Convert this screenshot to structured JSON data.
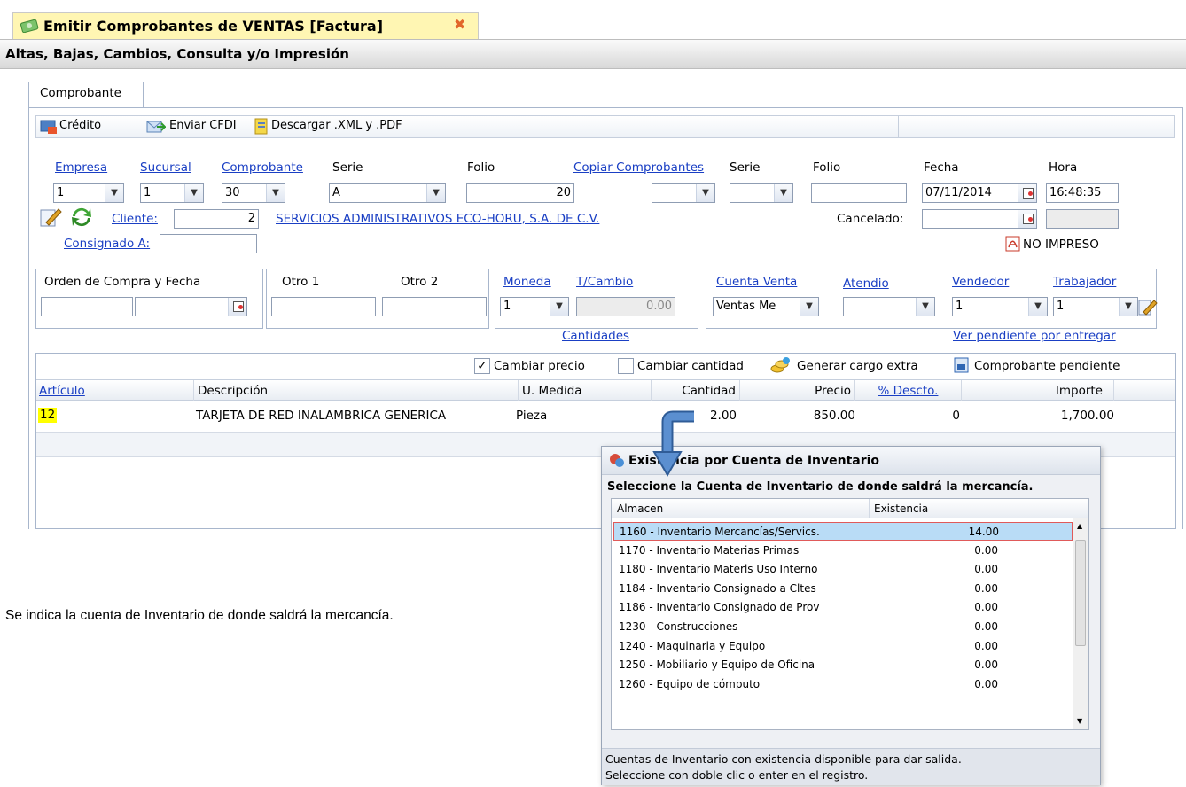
{
  "tab": {
    "title": "Emitir Comprobantes de VENTAS [Factura]"
  },
  "subheader": {
    "title": "Altas, Bajas, Cambios, Consulta y/o Impresión"
  },
  "inner_tab": {
    "label": "Comprobante"
  },
  "toolbar": {
    "credito": "Crédito",
    "enviar_cfdi": "Enviar CFDI",
    "descargar": "Descargar .XML y .PDF"
  },
  "form": {
    "empresa_label": "Empresa",
    "empresa_value": "1",
    "sucursal_label": "Sucursal",
    "sucursal_value": "1",
    "comprobante_label": "Comprobante",
    "comprobante_value": "30",
    "serie_label": "Serie",
    "serie_value": "A",
    "folio_label": "Folio",
    "folio_value": "20",
    "copiar_label": "Copiar Comprobantes",
    "serie2_label": "Serie",
    "folio2_label": "Folio",
    "fecha_label": "Fecha",
    "fecha_value": "07/11/2014",
    "hora_label": "Hora",
    "hora_value": "16:48:35",
    "cliente_label": "Cliente:",
    "cliente_value": "2",
    "cliente_nombre": "SERVICIOS ADMINISTRATIVOS ECO-HORU, S.A. DE C.V.",
    "cancelado_label": "Cancelado:",
    "consignado_label": "Consignado A:",
    "no_impreso": "NO IMPRESO"
  },
  "group1": {
    "orden_label": "Orden de Compra y Fecha",
    "otro1_label": "Otro 1",
    "otro2_label": "Otro 2"
  },
  "group2": {
    "moneda_label": "Moneda",
    "moneda_value": "1",
    "tcambio_label": "T/Cambio",
    "tcambio_value": "0.00",
    "cantidades_link": "Cantidades"
  },
  "group3": {
    "cuenta_venta_label": "Cuenta Venta",
    "cuenta_venta_value": "Ventas Me",
    "atendio_label": "Atendio",
    "vendedor_label": "Vendedor",
    "vendedor_value": "1",
    "trabajador_label": "Trabajador",
    "trabajador_value": "1",
    "ver_pendiente": "Ver pendiente por entregar"
  },
  "grid_options": {
    "cambiar_precio": "Cambiar precio",
    "cambiar_cantidad": "Cambiar cantidad",
    "generar_cargo": "Generar cargo extra",
    "comprobante_pendiente": "Comprobante pendiente"
  },
  "grid": {
    "headers": [
      "Artículo",
      "Descripción",
      "U. Medida",
      "Cantidad",
      "Precio",
      "% Descto.",
      "Importe"
    ],
    "row": [
      "12",
      "TARJETA DE RED INALAMBRICA GENERICA",
      "Pieza",
      "2.00",
      "850.00",
      "0",
      "1,700.00"
    ]
  },
  "caption": "Se indica la cuenta de Inventario de donde saldrá la mercancía.",
  "popup": {
    "title": "Existencia por Cuenta de Inventario",
    "instruction": "Seleccione la Cuenta de Inventario de donde saldrá la mercancía.",
    "col_almacen": "Almacen",
    "col_existencia": "Existencia",
    "rows": [
      {
        "name": "1160 - Inventario Mercancías/Servics.",
        "qty": "14.00"
      },
      {
        "name": "1170 - Inventario Materias Primas",
        "qty": "0.00"
      },
      {
        "name": "1180 - Inventario Materls Uso Interno",
        "qty": "0.00"
      },
      {
        "name": "1184 - Inventario Consignado a Cltes",
        "qty": "0.00"
      },
      {
        "name": "1186 - Inventario Consignado de Prov",
        "qty": "0.00"
      },
      {
        "name": "1230 - Construcciones",
        "qty": "0.00"
      },
      {
        "name": "1240 - Maquinaria y Equipo",
        "qty": "0.00"
      },
      {
        "name": "1250 - Mobiliario y Equipo de Oficina",
        "qty": "0.00"
      },
      {
        "name": "1260 - Equipo de cómputo",
        "qty": "0.00"
      }
    ],
    "footer_line1": "Cuentas de Inventario con existencia disponible para dar salida.",
    "footer_line2": "Seleccione con doble clic o enter en el registro."
  },
  "colors": {
    "tab_bg": "#fff7b8",
    "link": "#1a3fc4",
    "selected_row": "#b9dcf6",
    "highlight": "#ffff00",
    "arrow": "#3b6fb6"
  }
}
